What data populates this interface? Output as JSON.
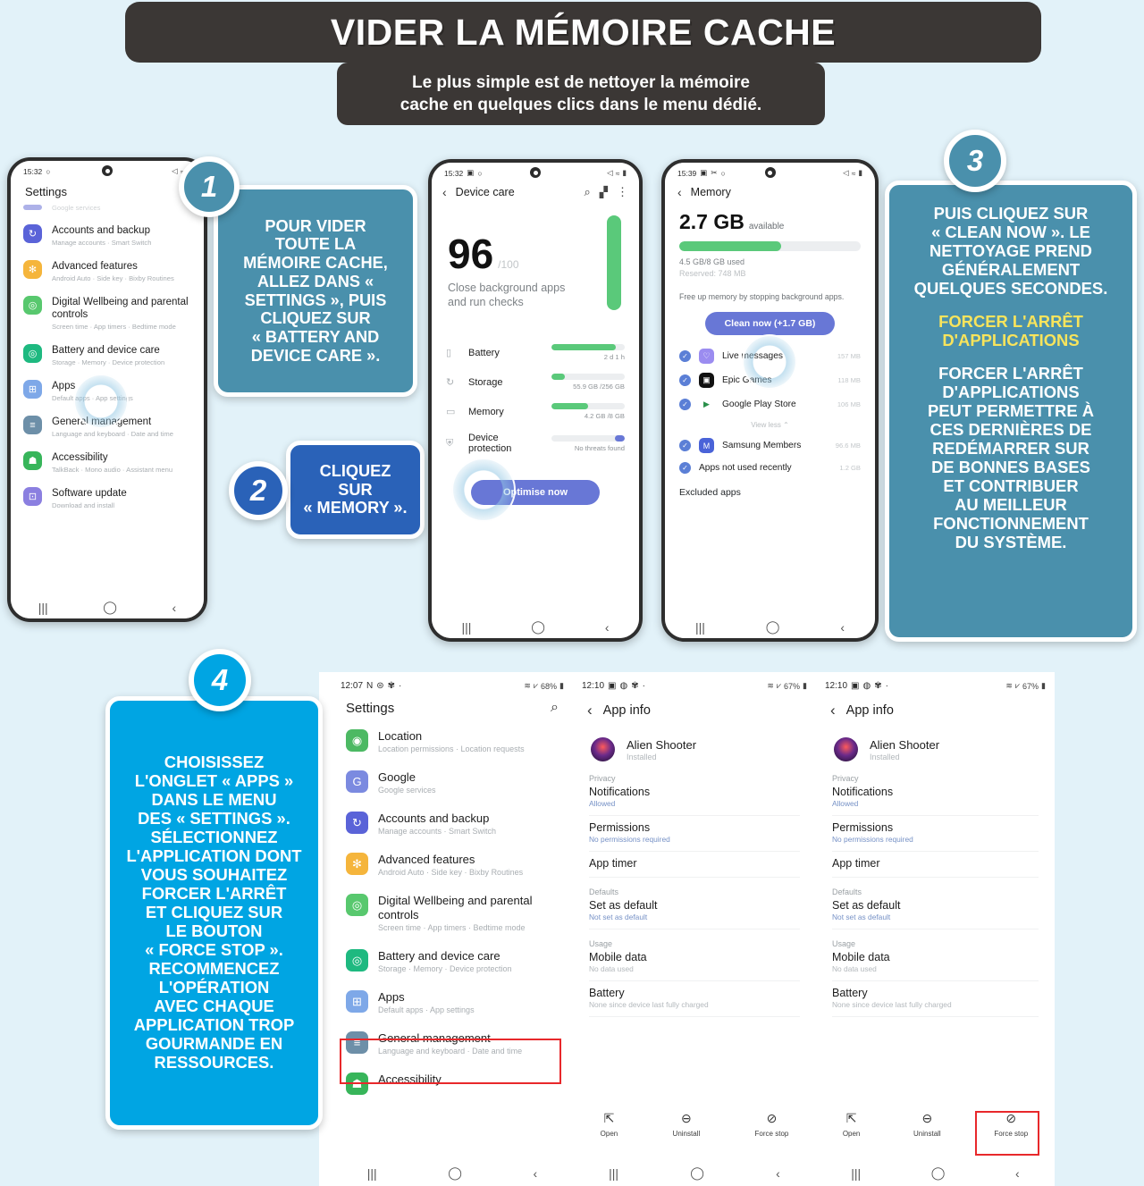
{
  "header": {
    "title": "VIDER LA MÉMOIRE CACHE",
    "subtitle_line1": "Le plus simple est de nettoyer la mémoire",
    "subtitle_line2": "cache en quelques clics dans le menu dédié.",
    "bar_color": "#3b3735"
  },
  "colors": {
    "background": "#e2f2f9",
    "teal": "#4a90ac",
    "royal_blue": "#2a62b8",
    "cyan": "#00a5e3",
    "yellow": "#f8e45c",
    "red_highlight": "#e8282b",
    "green": "#4cc36e",
    "samsung_blue": "#5f6fd8"
  },
  "steps": [
    {
      "number": "1",
      "badge_color": "#4a90ac",
      "box_color": "#4a90ac",
      "lines": [
        "POUR VIDER",
        "TOUTE LA",
        "MÉMOIRE CACHE,",
        "ALLEZ DANS «",
        "SETTINGS », PUIS",
        "CLIQUEZ SUR",
        "« BATTERY AND",
        "DEVICE CARE »."
      ]
    },
    {
      "number": "2",
      "badge_color": "#2a62b8",
      "box_color": "#2a62b8",
      "lines": [
        "CLIQUEZ",
        "SUR",
        "« MEMORY »."
      ]
    },
    {
      "number": "3",
      "badge_color": "#4a90ac",
      "box_color": "#4a90ac",
      "paragraph1": [
        "PUIS CLIQUEZ SUR",
        "« CLEAN NOW ». LE",
        "NETTOYAGE PREND",
        "GÉNÉRALEMENT",
        "QUELQUES SECONDES."
      ],
      "highlight": [
        "FORCER L'ARRÊT",
        "D'APPLICATIONS"
      ],
      "highlight_color": "#f8e45c",
      "paragraph2": [
        "FORCER L'ARRÊT",
        "D'APPLICATIONS",
        "PEUT PERMETTRE À",
        "CES DERNIÈRES DE",
        "REDÉMARRER SUR",
        "DE BONNES BASES",
        "ET CONTRIBUER",
        "AU MEILLEUR",
        "FONCTIONNEMENT",
        "DU SYSTÈME."
      ]
    },
    {
      "number": "4",
      "badge_color": "#00a5e3",
      "box_color": "#00a5e3",
      "lines": [
        "CHOISISSEZ",
        "L'ONGLET « APPS »",
        "DANS LE MENU",
        "DES « SETTINGS ».",
        "SÉLECTIONNEZ",
        "L'APPLICATION DONT",
        "VOUS SOUHAITEZ",
        "FORCER L'ARRÊT",
        "ET CLIQUEZ SUR",
        "LE BOUTON",
        "« FORCE STOP ».",
        "RECOMMENCEZ",
        "L'OPÉRATION",
        "AVEC CHAQUE",
        "APPLICATION TROP",
        "GOURMANDE EN",
        "RESSOURCES."
      ]
    }
  ],
  "phone1_settings": {
    "status_time": "15:32",
    "title": "Settings",
    "partial_top_sub": "Google services",
    "items": [
      {
        "title": "Accounts and backup",
        "sub": "Manage accounts  ·  Smart Switch",
        "icon_color": "#5a63d8",
        "glyph": "↻"
      },
      {
        "title": "Advanced features",
        "sub": "Android Auto  ·  Side key  ·  Bixby Routines",
        "icon_color": "#f5b53c",
        "glyph": "✻"
      },
      {
        "title": "Digital Wellbeing and parental controls",
        "sub": "Screen time  ·  App timers  ·  Bedtime mode",
        "icon_color": "#58c86e",
        "glyph": "◎"
      },
      {
        "title": "Battery and device care",
        "sub": "Storage  ·  Memory  ·  Device protection",
        "icon_color": "#1eb980",
        "glyph": "◎"
      },
      {
        "title": "Apps",
        "sub": "Default apps  ·  App settings",
        "icon_color": "#7ea8e8",
        "glyph": "⊞"
      },
      {
        "title": "General management",
        "sub": "Language and keyboard  ·  Date and time",
        "icon_color": "#6d8fa8",
        "glyph": "≡"
      },
      {
        "title": "Accessibility",
        "sub": "TalkBack  ·  Mono audio  ·  Assistant menu",
        "icon_color": "#37b55a",
        "glyph": "☗"
      },
      {
        "title": "Software update",
        "sub": "Download and install",
        "icon_color": "#8b7fe0",
        "glyph": "⊡"
      }
    ]
  },
  "phone2_devicecare": {
    "status_time": "15:32",
    "header_title": "Device care",
    "score": "96",
    "score_max": "/100",
    "score_desc_line1": "Close background apps",
    "score_desc_line2": "and run checks",
    "rows": [
      {
        "label": "Battery",
        "value": "2 d 1 h",
        "bar_pct": 88,
        "glyph": "▯"
      },
      {
        "label": "Storage",
        "value": "55.9 GB",
        "value_total": "/256 GB",
        "bar_pct": 18,
        "glyph": "↻"
      },
      {
        "label": "Memory",
        "value": "4.2 GB",
        "value_total": "/8 GB",
        "bar_pct": 50,
        "glyph": "▭"
      },
      {
        "label": "Device protection",
        "value": "No threats found",
        "bar_pct": 0,
        "glyph": "⛨"
      }
    ],
    "cta": "Optimise now"
  },
  "phone3_memory": {
    "status_time": "15:39",
    "header_title": "Memory",
    "available_value": "2.7 GB",
    "available_label": "available",
    "used_text": "4.5 GB/8 GB used",
    "reserved_text": "Reserved: 748 MB",
    "hint": "Free up memory by stopping background apps.",
    "clean_button": "Clean now (+1.7 GB)",
    "apps": [
      {
        "name": "Live messages",
        "size": "157 MB",
        "icon_color": "#9b8cf0",
        "glyph": "♡"
      },
      {
        "name": "Epic Games",
        "size": "118 MB",
        "icon_color": "#111111",
        "glyph": "▣"
      },
      {
        "name": "Google Play Store",
        "size": "106 MB",
        "icon_color": "#ffffff",
        "glyph": "▶"
      },
      {
        "name": "Samsung Members",
        "size": "96.6 MB",
        "icon_color": "#4a63d8",
        "glyph": "M"
      },
      {
        "name": "Apps not used recently",
        "size": "1.2 GB",
        "icon_color": "",
        "glyph": ""
      }
    ],
    "view_less": "View less",
    "excluded": "Excluded apps"
  },
  "phone4_settings": {
    "status_time": "12:07",
    "status_battery": "68%",
    "title": "Settings",
    "search_icon": "search-icon",
    "items": [
      {
        "title": "Location",
        "sub": "Location permissions  ·  Location requests",
        "icon_color": "#4cb963",
        "glyph": "◉"
      },
      {
        "title": "Google",
        "sub": "Google services",
        "icon_color": "#7b8ae0",
        "glyph": "G"
      },
      {
        "title": "Accounts and backup",
        "sub": "Manage accounts  ·  Smart Switch",
        "icon_color": "#5a63d8",
        "glyph": "↻"
      },
      {
        "title": "Advanced features",
        "sub": "Android Auto  ·  Side key  ·  Bixby Routines",
        "icon_color": "#f5b53c",
        "glyph": "✻"
      },
      {
        "title": "Digital Wellbeing and parental controls",
        "sub": "Screen time  ·  App timers  ·  Bedtime mode",
        "icon_color": "#58c86e",
        "glyph": "◎"
      },
      {
        "title": "Battery and device care",
        "sub": "Storage  ·  Memory  ·  Device protection",
        "icon_color": "#1eb980",
        "glyph": "◎"
      },
      {
        "title": "Apps",
        "sub": "Default apps  ·  App settings",
        "icon_color": "#7ea8e8",
        "glyph": "⊞",
        "highlighted": true
      },
      {
        "title": "General management",
        "sub": "Language and keyboard  ·  Date and time",
        "icon_color": "#6d8fa8",
        "glyph": "≡"
      },
      {
        "title": "Accessibility",
        "sub": "",
        "icon_color": "#37b55a",
        "glyph": "☗"
      }
    ]
  },
  "phone5_appinfo": {
    "status_time": "12:10",
    "status_battery": "67%",
    "header_title": "App info",
    "app_name": "Alien Shooter",
    "app_state": "Installed",
    "sections": [
      {
        "label": "Privacy",
        "rows": [
          {
            "title": "Notifications",
            "sub": "Allowed",
            "sub_blue": true
          },
          {
            "title": "Permissions",
            "sub": "No permissions required",
            "sub_blue": true
          },
          {
            "title": "App timer",
            "sub": "",
            "sub_blue": false
          }
        ]
      },
      {
        "label": "Defaults",
        "rows": [
          {
            "title": "Set as default",
            "sub": "Not set as default",
            "sub_blue": true
          }
        ]
      },
      {
        "label": "Usage",
        "rows": [
          {
            "title": "Mobile data",
            "sub": "No data used",
            "sub_blue": false
          },
          {
            "title": "Battery",
            "sub": "None since device last fully charged",
            "sub_blue": false
          }
        ]
      }
    ],
    "actions": [
      {
        "label": "Open",
        "icon": "open-external-icon"
      },
      {
        "label": "Uninstall",
        "icon": "minus-circle-icon"
      },
      {
        "label": "Force stop",
        "icon": "stop-circle-icon"
      }
    ]
  },
  "phone6_appinfo": {
    "status_time": "12:10",
    "status_battery": "67%",
    "header_title": "App info",
    "app_name": "Alien Shooter",
    "app_state": "Installed",
    "force_stop_highlighted": true
  }
}
